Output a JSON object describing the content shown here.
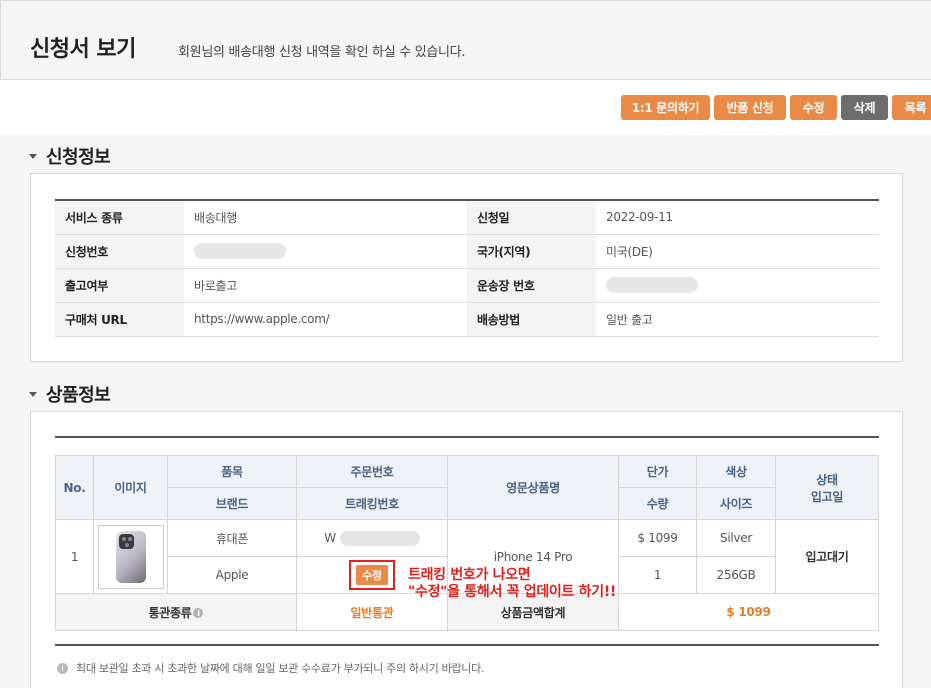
{
  "header": {
    "title": "신청서 보기",
    "description": "회원님의 배송대행 신청 내역을 확인 하실 수 있습니다."
  },
  "toolbar": {
    "inquiry_label": "1:1 문의하기",
    "return_label": "반품 신청",
    "edit_label": "수정",
    "delete_label": "삭제",
    "list_label": "목록"
  },
  "colors": {
    "accent": "#ea8a47",
    "dark_button": "#6d6d6d",
    "annotation": "#e0201a",
    "header_text": "#4b6284"
  },
  "request_section": {
    "title": "신청정보",
    "rows": [
      {
        "k1": "서비스 종류",
        "v1": "배송대행",
        "k2": "신청일",
        "v2": "2022-09-11"
      },
      {
        "k1": "신청번호",
        "v1": "",
        "k2": "국가(지역)",
        "v2": "미국(DE)"
      },
      {
        "k1": "출고여부",
        "v1": "바로출고",
        "k2": "운송장 번호",
        "v2": ""
      },
      {
        "k1": "구매처 URL",
        "v1": "https://www.apple.com/",
        "k2": "배송방법",
        "v2": "일반 출고"
      }
    ]
  },
  "product_section": {
    "title": "상품정보",
    "headers": {
      "no": "No.",
      "image": "이미지",
      "item": "품목",
      "brand": "브랜드",
      "order_no": "주문번호",
      "tracking_no": "트래킹번호",
      "english_name": "영문상품명",
      "unit_price": "단가",
      "quantity": "수량",
      "color": "색상",
      "size": "사이즈",
      "status": "상태",
      "received_date": "입고일"
    },
    "row": {
      "no": "1",
      "image_icon": "iphone-product-image",
      "item": "휴대폰",
      "brand": "Apple",
      "order_prefix": "W",
      "tracking_edit_label": "수정",
      "english_name": "iPhone 14 Pro",
      "unit_price": "$ 1099",
      "quantity": "1",
      "color": "Silver",
      "size": "256GB",
      "status": "입고대기"
    },
    "summary": {
      "customs_label": "통관종류",
      "customs_value": "일반통관",
      "total_label": "상품금액합계",
      "total_value": "$ 1099"
    },
    "notice": "최대 보관일 초과 시 초과한 날짜에 대해 일일 보관 수수료가 부가되니 주의 하시기 바랍니다."
  },
  "annotation": {
    "line1": "트래킹 번호가 나오면",
    "line2": "\"수정\"을 통해서 꼭 업데이트 하기!!"
  }
}
